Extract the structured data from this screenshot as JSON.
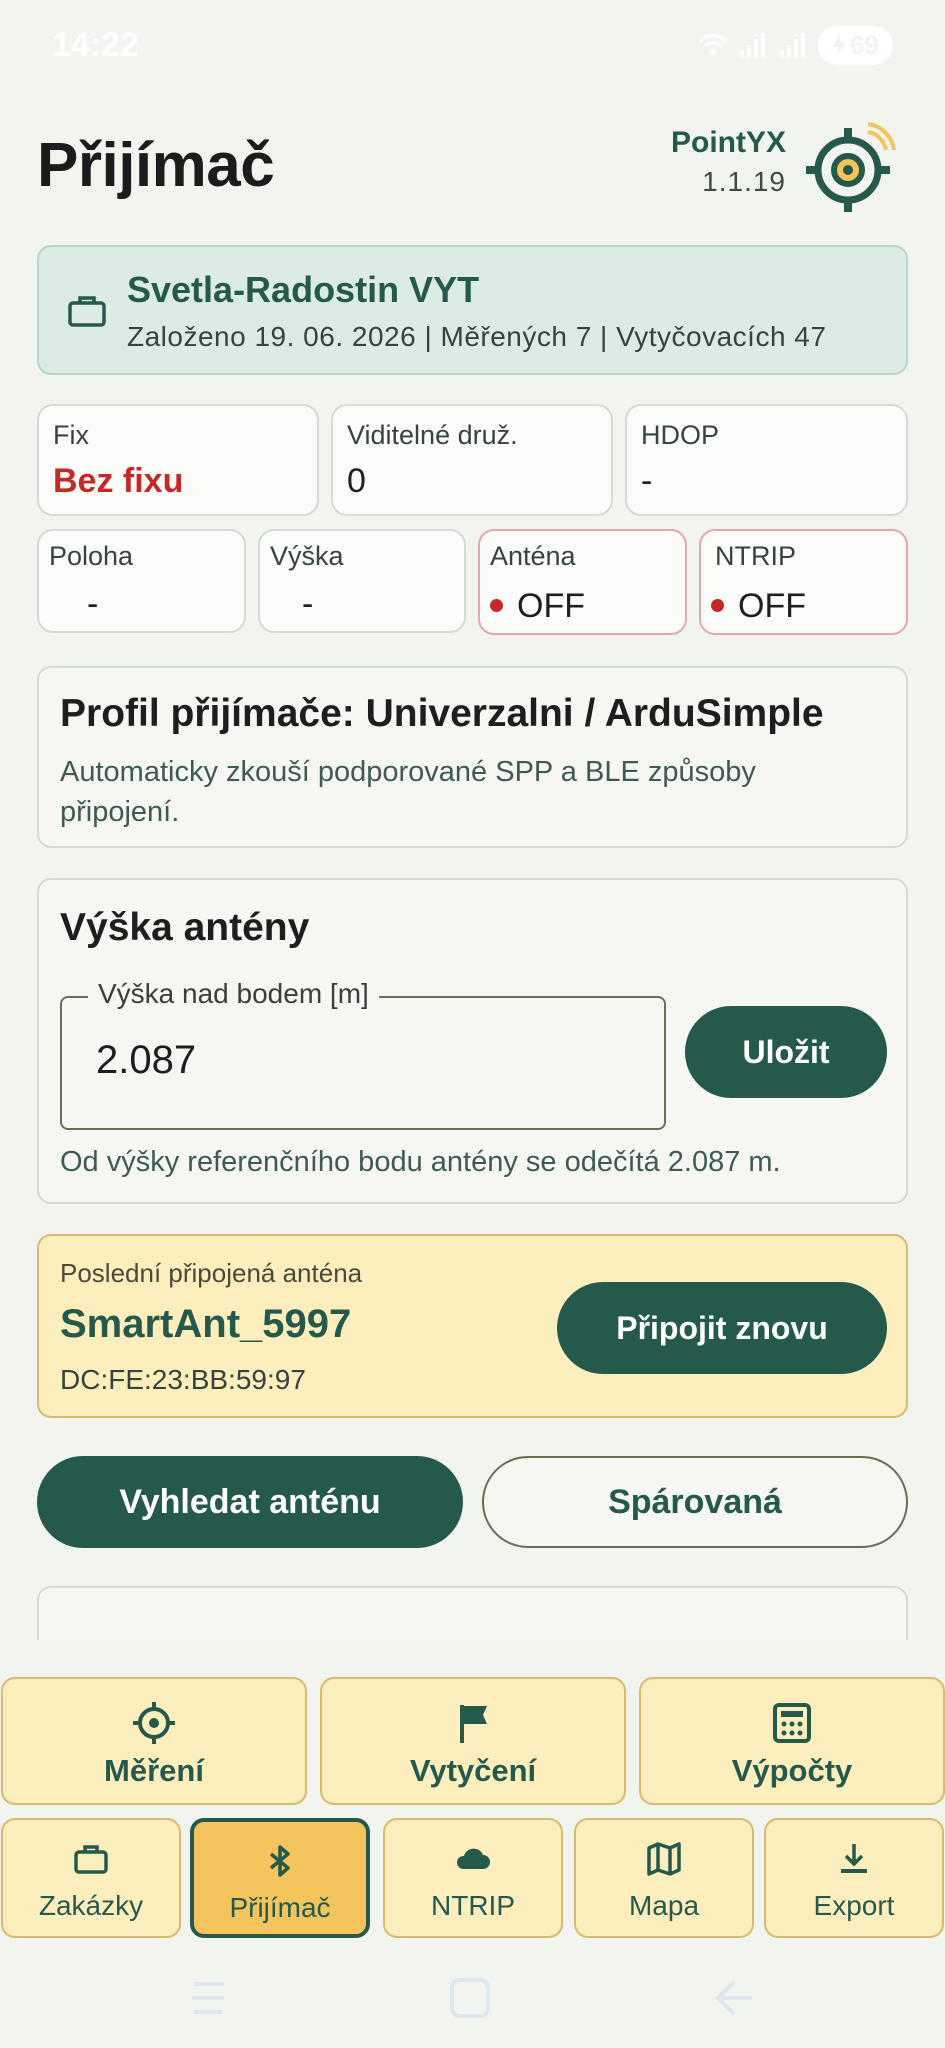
{
  "status_bar": {
    "time": "14:22",
    "battery": "69"
  },
  "header": {
    "title": "Přijímač",
    "app_name": "PointYX",
    "app_version": "1.1.19"
  },
  "project": {
    "name": "Svetla-Radostin VYT",
    "meta": "Založeno 19. 06. 2026 | Měřených 7 | Vytyčovacích 47"
  },
  "status_tiles": {
    "fix": {
      "label": "Fix",
      "value": "Bez fixu"
    },
    "satellites": {
      "label": "Viditelné druž.",
      "value": "0"
    },
    "hdop": {
      "label": "HDOP",
      "value": "-"
    },
    "position": {
      "label": "Poloha",
      "value": "-"
    },
    "height": {
      "label": "Výška",
      "value": "-"
    },
    "antenna": {
      "label": "Anténa",
      "value": "OFF"
    },
    "ntrip": {
      "label": "NTRIP",
      "value": "OFF"
    }
  },
  "profile": {
    "title": "Profil přijímače: Univerzalni / ArduSimple",
    "description": "Automaticky zkouší podporované SPP a BLE způsoby připojení."
  },
  "antenna_height": {
    "title": "Výška antény",
    "field_label": "Výška nad bodem [m]",
    "field_value": "2.087",
    "save_label": "Uložit",
    "note": "Od výšky referenčního bodu antény se odečítá 2.087 m."
  },
  "last_antenna": {
    "label": "Poslední připojená anténa",
    "name": "SmartAnt_5997",
    "mac": "DC:FE:23:BB:59:97",
    "reconnect_label": "Připojit znovu"
  },
  "actions": {
    "search_label": "Vyhledat anténu",
    "paired_label": "Spárovaná"
  },
  "nav_primary": [
    {
      "label": "Měření",
      "icon": "crosshair-icon"
    },
    {
      "label": "Vytyčení",
      "icon": "flag-icon"
    },
    {
      "label": "Výpočty",
      "icon": "calculator-icon"
    }
  ],
  "nav_secondary": [
    {
      "label": "Zakázky",
      "icon": "briefcase-icon"
    },
    {
      "label": "Přijímač",
      "icon": "bluetooth-icon",
      "active": true
    },
    {
      "label": "NTRIP",
      "icon": "cloud-icon"
    },
    {
      "label": "Mapa",
      "icon": "map-icon"
    },
    {
      "label": "Export",
      "icon": "download-icon"
    }
  ],
  "colors": {
    "primary": "#24594b",
    "background": "#f2f4ef",
    "alert": "#c62828",
    "nav_bg": "#fdeebe",
    "nav_active": "#f4c55d"
  }
}
